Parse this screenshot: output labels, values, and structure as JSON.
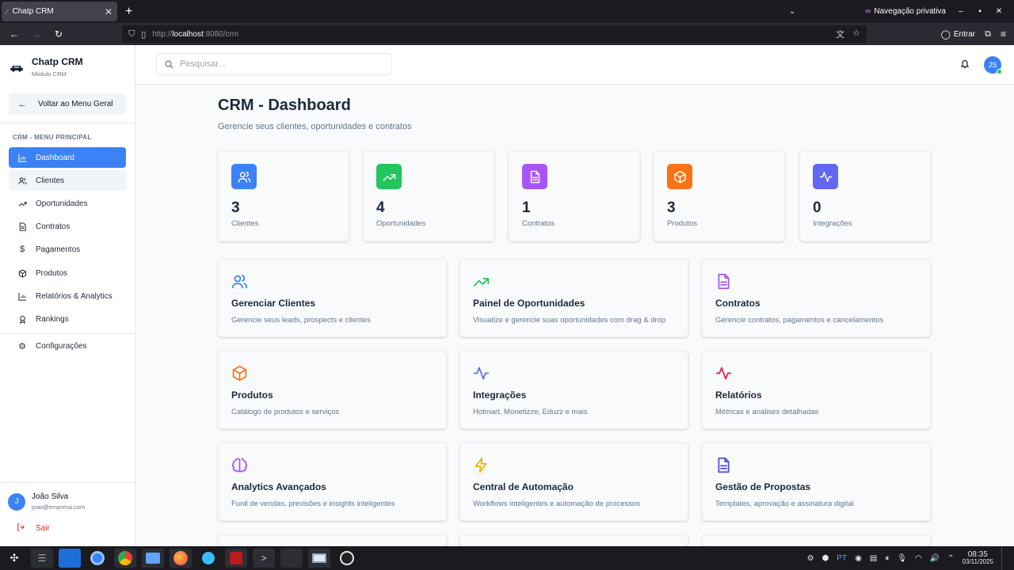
{
  "browser": {
    "tab_title": "Chatp CRM",
    "private_label": "Navegação privativa",
    "url_prefix": "http://",
    "url_host": "localhost",
    "url_rest": ":8080/crm",
    "signin_label": "Entrar"
  },
  "sidebar": {
    "app_name": "Chatp CRM",
    "module": "Módulo CRM",
    "back_label": "Voltar ao Menu Geral",
    "menu_title": "CRM - MENU PRINCIPAL",
    "items": [
      {
        "label": "Dashboard",
        "icon": "bar-chart-icon"
      },
      {
        "label": "Clientes",
        "icon": "users-icon"
      },
      {
        "label": "Oportunidades",
        "icon": "trending-up-icon"
      },
      {
        "label": "Contratos",
        "icon": "file-text-icon"
      },
      {
        "label": "Pagamentos",
        "icon": "dollar-icon"
      },
      {
        "label": "Produtos",
        "icon": "box-icon"
      },
      {
        "label": "Relatórios & Analytics",
        "icon": "bar-chart-icon"
      },
      {
        "label": "Rankings",
        "icon": "award-icon"
      }
    ],
    "settings_label": "Configurações",
    "user": {
      "initial": "J",
      "name": "João Silva",
      "email": "joao@empresa.com"
    },
    "logout_label": "Sair"
  },
  "header": {
    "search_placeholder": "Pesquisar...",
    "avatar_initials": "JS"
  },
  "main": {
    "title": "CRM - Dashboard",
    "subtitle": "Gerencie seus clientes, oportunidades e contratos",
    "stats": [
      {
        "value": "3",
        "label": "Clientes",
        "color": "#3b82f6",
        "icon": "users-icon"
      },
      {
        "value": "4",
        "label": "Oportunidades",
        "color": "#22c55e",
        "icon": "trending-up-icon"
      },
      {
        "value": "1",
        "label": "Contratos",
        "color": "#a855f7",
        "icon": "file-text-icon"
      },
      {
        "value": "3",
        "label": "Produtos",
        "color": "#f97316",
        "icon": "box-icon"
      },
      {
        "value": "0",
        "label": "Integrações",
        "color": "#6366f1",
        "icon": "activity-icon"
      }
    ],
    "cards": [
      {
        "title": "Gerenciar Clientes",
        "desc": "Gerencie seus leads, prospects e clientes",
        "color": "#3b82f6",
        "icon": "users-icon"
      },
      {
        "title": "Painel de Oportunidades",
        "desc": "Visualize e gerencie suas oportunidades com drag & drop",
        "color": "#22c55e",
        "icon": "trending-up-icon"
      },
      {
        "title": "Contratos",
        "desc": "Gerencie contratos, pagamentos e cancelamentos",
        "color": "#a855f7",
        "icon": "file-text-icon"
      },
      {
        "title": "Produtos",
        "desc": "Catálogo de produtos e serviços",
        "color": "#f97316",
        "icon": "box-icon"
      },
      {
        "title": "Integrações",
        "desc": "Hotmart, Monetizze, Eduzz e mais",
        "color": "#6366f1",
        "icon": "activity-icon"
      },
      {
        "title": "Relatórios",
        "desc": "Métricas e análises detalhadas",
        "color": "#e11d48",
        "icon": "activity-icon"
      },
      {
        "title": "Analytics Avançados",
        "desc": "Funil de vendas, previsões e insights inteligentes",
        "color": "#a855f7",
        "icon": "brain-icon"
      },
      {
        "title": "Central de Automação",
        "desc": "Workflows inteligentes e automação de processos",
        "color": "#eab308",
        "icon": "zap-icon"
      },
      {
        "title": "Gestão de Propostas",
        "desc": "Templates, aprovação e assinatura digital",
        "color": "#4f46e5",
        "icon": "file-text-icon"
      }
    ]
  },
  "taskbar": {
    "lang": "PT",
    "time": "08:35",
    "date": "03/11/2025"
  }
}
